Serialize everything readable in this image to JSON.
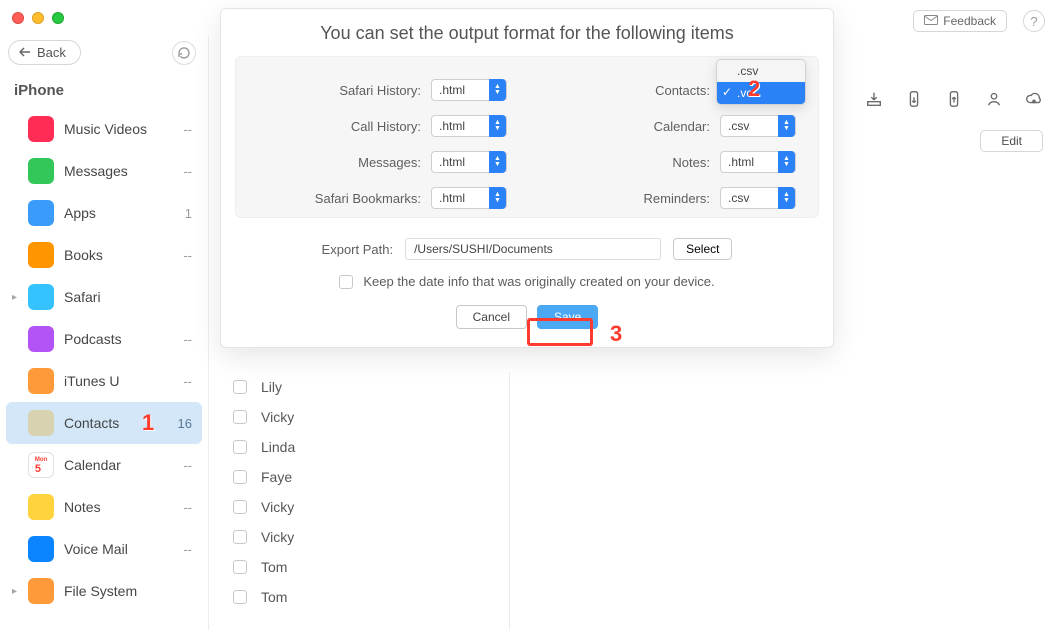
{
  "window": {
    "feedback": "Feedback",
    "back": "Back",
    "device": "iPhone",
    "edit": "Edit"
  },
  "sidebar": {
    "items": [
      {
        "label": "Music Videos",
        "badge": "--",
        "color": "#ff2d55"
      },
      {
        "label": "Messages",
        "badge": "--",
        "color": "#33c759"
      },
      {
        "label": "Apps",
        "badge": "1",
        "color": "#3a9bfb"
      },
      {
        "label": "Books",
        "badge": "--",
        "color": "#ff9500"
      },
      {
        "label": "Safari",
        "badge": "",
        "color": "#34c3ff",
        "disclosure": true
      },
      {
        "label": "Podcasts",
        "badge": "--",
        "color": "#b353f6"
      },
      {
        "label": "iTunes U",
        "badge": "--",
        "color": "#ff9a3b"
      },
      {
        "label": "Contacts",
        "badge": "16",
        "color": "#d9d2b0",
        "selected": true
      },
      {
        "label": "Calendar",
        "badge": "--",
        "color": "#ffffff"
      },
      {
        "label": "Notes",
        "badge": "--",
        "color": "#ffd33d"
      },
      {
        "label": "Voice Mail",
        "badge": "--",
        "color": "#0a84ff"
      },
      {
        "label": "File System",
        "badge": "",
        "color": "#ff9a3b",
        "disclosure": true
      }
    ]
  },
  "contacts": {
    "rows": [
      "Lily",
      "Vicky",
      "Linda",
      "Faye",
      "Vicky",
      "Vicky",
      "Tom",
      "Tom"
    ]
  },
  "modal": {
    "title": "You can set the output format for the following items",
    "fields": {
      "safari_history": {
        "label": "Safari History:",
        "value": ".html"
      },
      "call_history": {
        "label": "Call History:",
        "value": ".html"
      },
      "messages": {
        "label": "Messages:",
        "value": ".html"
      },
      "safari_bookmarks": {
        "label": "Safari Bookmarks:",
        "value": ".html"
      },
      "contacts": {
        "label": "Contacts:",
        "value": ".vcf",
        "options": [
          ".csv",
          ".vcf"
        ]
      },
      "calendar": {
        "label": "Calendar:",
        "value": ".csv"
      },
      "notes": {
        "label": "Notes:",
        "value": ".html"
      },
      "reminders": {
        "label": "Reminders:",
        "value": ".csv"
      }
    },
    "export_label": "Export Path:",
    "export_path": "/Users/SUSHI/Documents",
    "select_btn": "Select",
    "keep_date": "Keep the date info that was originally created on your device.",
    "cancel": "Cancel",
    "save": "Save"
  },
  "callouts": {
    "one": "1",
    "two": "2",
    "three": "3"
  }
}
